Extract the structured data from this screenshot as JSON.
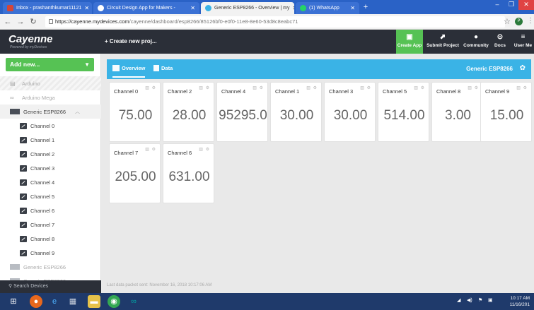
{
  "browser": {
    "tabs": [
      {
        "title": "Inbox - prashanthkumar11121",
        "active": false,
        "fav_color": "#d44638"
      },
      {
        "title": "Circuit Design App for Makers -",
        "active": false,
        "fav_color": "#ffffff"
      },
      {
        "title": "Generic ESP8266 - Overview | my",
        "active": true,
        "fav_color": "#3ab3e6"
      },
      {
        "title": "(1) WhatsApp",
        "active": false,
        "fav_color": "#25d366"
      }
    ],
    "url_host": "https://cayenne.mydevices.com",
    "url_path": "/cayenne/dashboard/esp8266/85126bf0-e0f0-11e8-8e60-53d8c8eabc71",
    "profile_initial": "P"
  },
  "header": {
    "logo": "Cayenne",
    "logo_sub": "Powered by myDevices",
    "create_project": "+ Create new proj...",
    "buttons": [
      {
        "label": "Create App",
        "icon": "app-icon"
      },
      {
        "label": "Submit Project",
        "icon": "submit-icon"
      },
      {
        "label": "Community",
        "icon": "community-icon"
      },
      {
        "label": "Docs",
        "icon": "docs-icon"
      },
      {
        "label": "User Me",
        "icon": "menu-icon"
      }
    ]
  },
  "sidebar": {
    "add_new": "Add new...",
    "items": [
      {
        "label": "Arduino",
        "kind": "grey-top"
      },
      {
        "label": "Arduino Mega",
        "kind": "grey"
      },
      {
        "label": "Generic ESP8266",
        "kind": "section"
      },
      {
        "label": "Channel 0",
        "kind": "child"
      },
      {
        "label": "Channel 1",
        "kind": "child"
      },
      {
        "label": "Channel 2",
        "kind": "child"
      },
      {
        "label": "Channel 3",
        "kind": "child"
      },
      {
        "label": "Channel 4",
        "kind": "child"
      },
      {
        "label": "Channel 5",
        "kind": "child"
      },
      {
        "label": "Channel 6",
        "kind": "child"
      },
      {
        "label": "Channel 7",
        "kind": "child"
      },
      {
        "label": "Channel 8",
        "kind": "child"
      },
      {
        "label": "Channel 9",
        "kind": "child"
      },
      {
        "label": "Generic ESP8266",
        "kind": "grey-board"
      },
      {
        "label": "Generic ESP8266",
        "kind": "grey-board"
      }
    ],
    "search": "Search Devices"
  },
  "toolbar": {
    "tab_overview": "Overview",
    "tab_data": "Data",
    "device_name": "Generic ESP8266"
  },
  "widgets": [
    {
      "name": "Channel 0",
      "value": "75.00"
    },
    {
      "name": "Channel 2",
      "value": "28.00"
    },
    {
      "name": "Channel 4",
      "value": "95295.0"
    },
    {
      "name": "Channel 1",
      "value": "30.00"
    },
    {
      "name": "Channel 3",
      "value": "30.00"
    },
    {
      "name": "Channel 5",
      "value": "514.00"
    },
    {
      "name": "Channel 8",
      "value": "3.00"
    },
    {
      "name": "Channel 9",
      "value": "15.00"
    },
    {
      "name": "Channel 7",
      "value": "205.00"
    },
    {
      "name": "Channel 6",
      "value": "631.00"
    }
  ],
  "status": "Last data packet sent: November 16, 2018 10:17:06 AM",
  "taskbar": {
    "time": "10:17 AM",
    "date": "11/16/201"
  }
}
